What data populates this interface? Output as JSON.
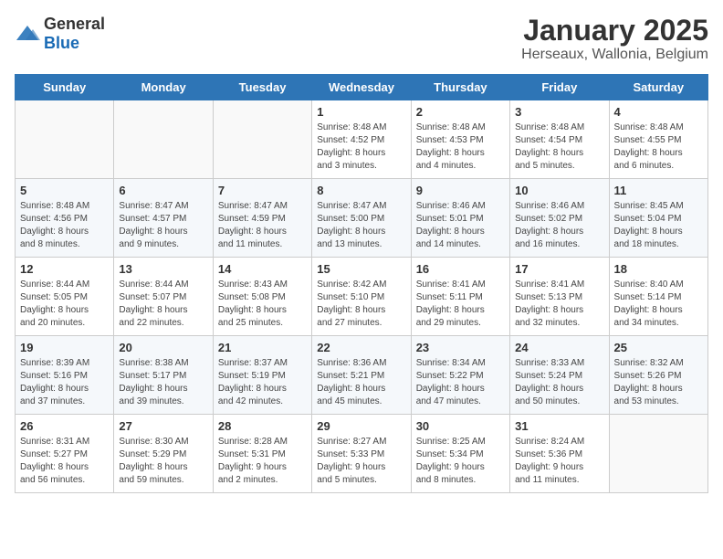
{
  "logo": {
    "general": "General",
    "blue": "Blue"
  },
  "header": {
    "title": "January 2025",
    "subtitle": "Herseaux, Wallonia, Belgium"
  },
  "days_of_week": [
    "Sunday",
    "Monday",
    "Tuesday",
    "Wednesday",
    "Thursday",
    "Friday",
    "Saturday"
  ],
  "weeks": [
    [
      {
        "day": "",
        "info": ""
      },
      {
        "day": "",
        "info": ""
      },
      {
        "day": "",
        "info": ""
      },
      {
        "day": "1",
        "info": "Sunrise: 8:48 AM\nSunset: 4:52 PM\nDaylight: 8 hours\nand 3 minutes."
      },
      {
        "day": "2",
        "info": "Sunrise: 8:48 AM\nSunset: 4:53 PM\nDaylight: 8 hours\nand 4 minutes."
      },
      {
        "day": "3",
        "info": "Sunrise: 8:48 AM\nSunset: 4:54 PM\nDaylight: 8 hours\nand 5 minutes."
      },
      {
        "day": "4",
        "info": "Sunrise: 8:48 AM\nSunset: 4:55 PM\nDaylight: 8 hours\nand 6 minutes."
      }
    ],
    [
      {
        "day": "5",
        "info": "Sunrise: 8:48 AM\nSunset: 4:56 PM\nDaylight: 8 hours\nand 8 minutes."
      },
      {
        "day": "6",
        "info": "Sunrise: 8:47 AM\nSunset: 4:57 PM\nDaylight: 8 hours\nand 9 minutes."
      },
      {
        "day": "7",
        "info": "Sunrise: 8:47 AM\nSunset: 4:59 PM\nDaylight: 8 hours\nand 11 minutes."
      },
      {
        "day": "8",
        "info": "Sunrise: 8:47 AM\nSunset: 5:00 PM\nDaylight: 8 hours\nand 13 minutes."
      },
      {
        "day": "9",
        "info": "Sunrise: 8:46 AM\nSunset: 5:01 PM\nDaylight: 8 hours\nand 14 minutes."
      },
      {
        "day": "10",
        "info": "Sunrise: 8:46 AM\nSunset: 5:02 PM\nDaylight: 8 hours\nand 16 minutes."
      },
      {
        "day": "11",
        "info": "Sunrise: 8:45 AM\nSunset: 5:04 PM\nDaylight: 8 hours\nand 18 minutes."
      }
    ],
    [
      {
        "day": "12",
        "info": "Sunrise: 8:44 AM\nSunset: 5:05 PM\nDaylight: 8 hours\nand 20 minutes."
      },
      {
        "day": "13",
        "info": "Sunrise: 8:44 AM\nSunset: 5:07 PM\nDaylight: 8 hours\nand 22 minutes."
      },
      {
        "day": "14",
        "info": "Sunrise: 8:43 AM\nSunset: 5:08 PM\nDaylight: 8 hours\nand 25 minutes."
      },
      {
        "day": "15",
        "info": "Sunrise: 8:42 AM\nSunset: 5:10 PM\nDaylight: 8 hours\nand 27 minutes."
      },
      {
        "day": "16",
        "info": "Sunrise: 8:41 AM\nSunset: 5:11 PM\nDaylight: 8 hours\nand 29 minutes."
      },
      {
        "day": "17",
        "info": "Sunrise: 8:41 AM\nSunset: 5:13 PM\nDaylight: 8 hours\nand 32 minutes."
      },
      {
        "day": "18",
        "info": "Sunrise: 8:40 AM\nSunset: 5:14 PM\nDaylight: 8 hours\nand 34 minutes."
      }
    ],
    [
      {
        "day": "19",
        "info": "Sunrise: 8:39 AM\nSunset: 5:16 PM\nDaylight: 8 hours\nand 37 minutes."
      },
      {
        "day": "20",
        "info": "Sunrise: 8:38 AM\nSunset: 5:17 PM\nDaylight: 8 hours\nand 39 minutes."
      },
      {
        "day": "21",
        "info": "Sunrise: 8:37 AM\nSunset: 5:19 PM\nDaylight: 8 hours\nand 42 minutes."
      },
      {
        "day": "22",
        "info": "Sunrise: 8:36 AM\nSunset: 5:21 PM\nDaylight: 8 hours\nand 45 minutes."
      },
      {
        "day": "23",
        "info": "Sunrise: 8:34 AM\nSunset: 5:22 PM\nDaylight: 8 hours\nand 47 minutes."
      },
      {
        "day": "24",
        "info": "Sunrise: 8:33 AM\nSunset: 5:24 PM\nDaylight: 8 hours\nand 50 minutes."
      },
      {
        "day": "25",
        "info": "Sunrise: 8:32 AM\nSunset: 5:26 PM\nDaylight: 8 hours\nand 53 minutes."
      }
    ],
    [
      {
        "day": "26",
        "info": "Sunrise: 8:31 AM\nSunset: 5:27 PM\nDaylight: 8 hours\nand 56 minutes."
      },
      {
        "day": "27",
        "info": "Sunrise: 8:30 AM\nSunset: 5:29 PM\nDaylight: 8 hours\nand 59 minutes."
      },
      {
        "day": "28",
        "info": "Sunrise: 8:28 AM\nSunset: 5:31 PM\nDaylight: 9 hours\nand 2 minutes."
      },
      {
        "day": "29",
        "info": "Sunrise: 8:27 AM\nSunset: 5:33 PM\nDaylight: 9 hours\nand 5 minutes."
      },
      {
        "day": "30",
        "info": "Sunrise: 8:25 AM\nSunset: 5:34 PM\nDaylight: 9 hours\nand 8 minutes."
      },
      {
        "day": "31",
        "info": "Sunrise: 8:24 AM\nSunset: 5:36 PM\nDaylight: 9 hours\nand 11 minutes."
      },
      {
        "day": "",
        "info": ""
      }
    ]
  ]
}
